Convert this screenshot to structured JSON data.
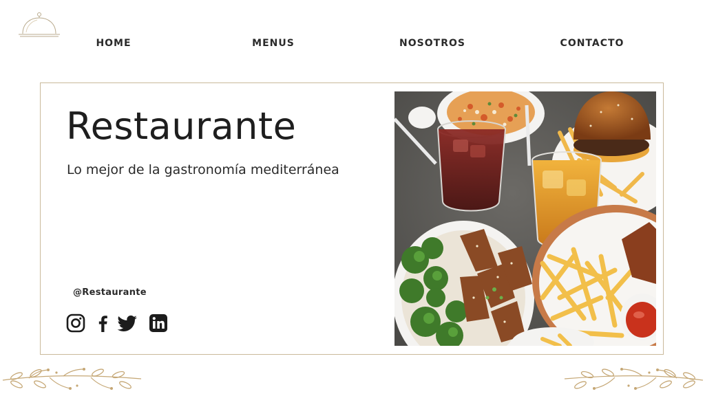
{
  "nav": {
    "items": [
      "HOME",
      "MENUS",
      "NOSOTROS",
      "CONTACTO"
    ]
  },
  "hero": {
    "title": "Restaurante",
    "subtitle": "Lo mejor de la gastronomía mediterránea",
    "handle": "@Restaurante"
  },
  "social": {
    "icons": [
      "instagram-icon",
      "facebook-icon",
      "twitter-icon",
      "linkedin-icon"
    ]
  },
  "colors": {
    "border": "#c9b99a",
    "text": "#222222",
    "accent": "#c8a97a"
  }
}
